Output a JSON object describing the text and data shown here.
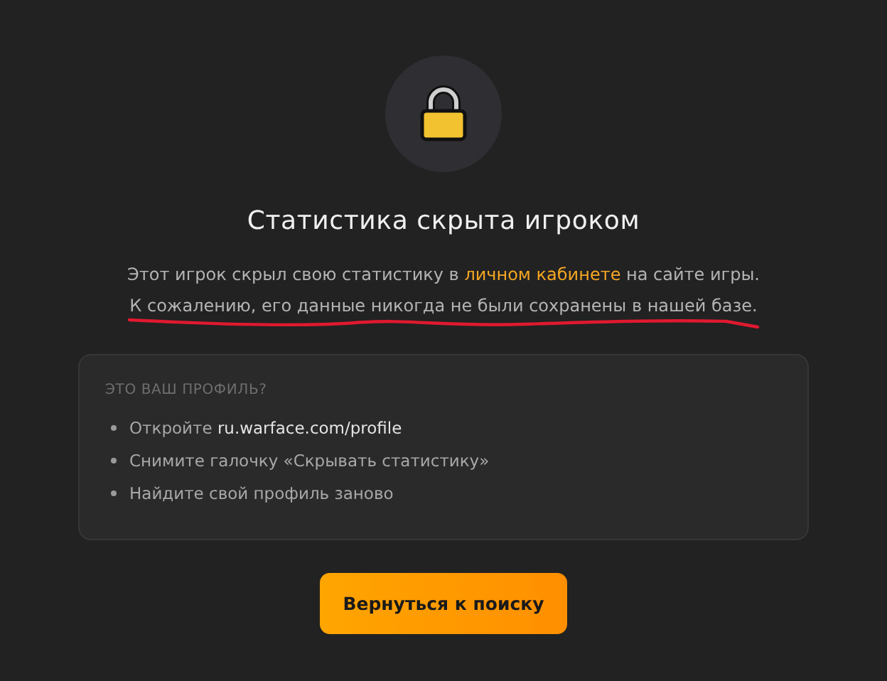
{
  "title": "Статистика скрыта игроком",
  "message": {
    "before": "Этот игрок скрыл свою статистику в ",
    "link": "личном кабинете",
    "after": " на сайте игры."
  },
  "note": "К сожалению, его данные никогда не были сохранены в нашей базе.",
  "help": {
    "heading": "ЭТО ВАШ ПРОФИЛЬ?",
    "items": [
      "Откройте **ru.warface.com/profile**",
      "Снимите галочку «Скрывать статистику»",
      "Найдите свой профиль заново"
    ]
  },
  "button": "Вернуться к поиску"
}
